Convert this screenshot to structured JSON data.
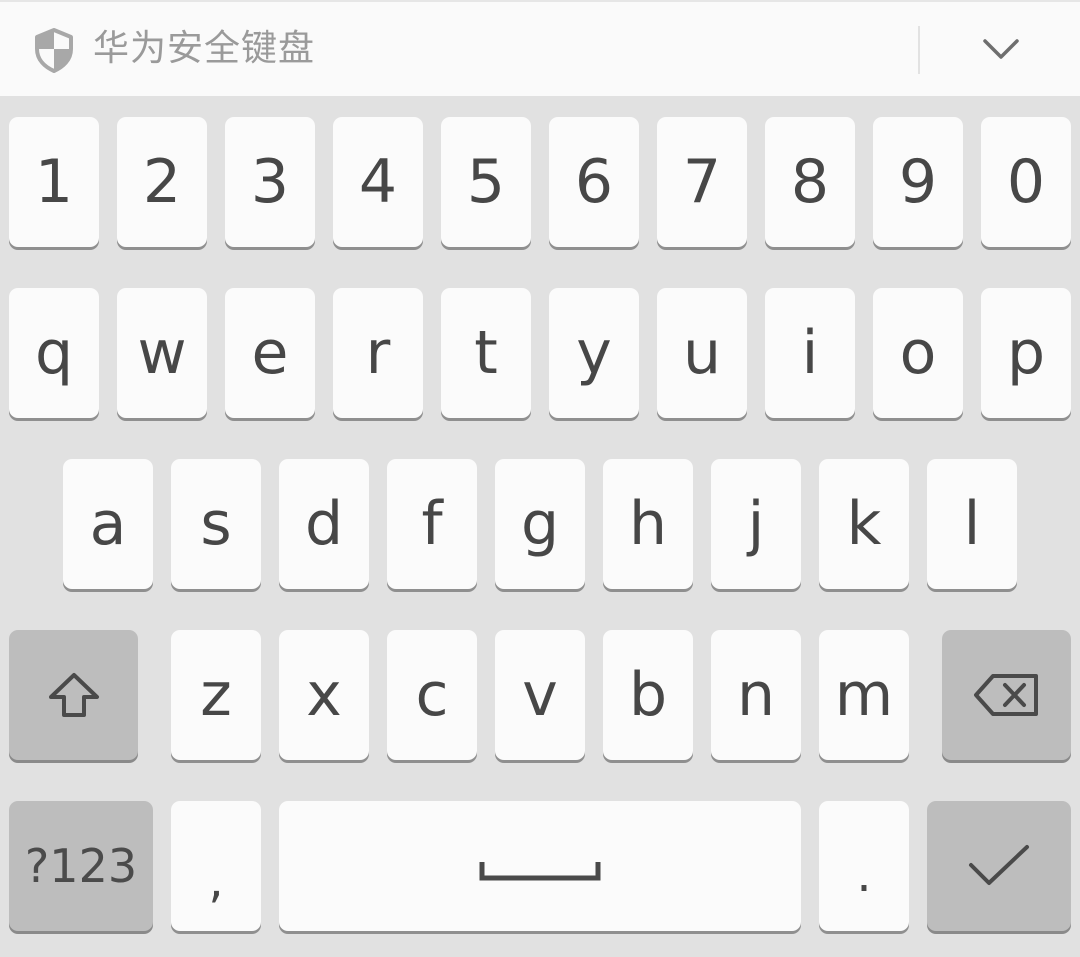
{
  "header": {
    "title": "华为安全键盘",
    "shield_icon": "shield-icon",
    "collapse_icon": "chevron-down-icon"
  },
  "keyboard": {
    "row_digits": [
      "1",
      "2",
      "3",
      "4",
      "5",
      "6",
      "7",
      "8",
      "9",
      "0"
    ],
    "row_top": [
      "q",
      "w",
      "e",
      "r",
      "t",
      "y",
      "u",
      "i",
      "o",
      "p"
    ],
    "row_home": [
      "a",
      "s",
      "d",
      "f",
      "g",
      "h",
      "j",
      "k",
      "l"
    ],
    "row_bottom": [
      "z",
      "x",
      "c",
      "v",
      "b",
      "n",
      "m"
    ],
    "shift_icon": "shift-arrow-icon",
    "backspace_icon": "backspace-icon",
    "symbols_label": "?123",
    "comma_label": ",",
    "period_label": ".",
    "space_icon": "space-bar-icon",
    "enter_icon": "checkmark-icon"
  },
  "colors": {
    "panel_background": "#e1e1e1",
    "key_background": "#fbfbfb",
    "function_key_background": "#bdbdbd",
    "key_text": "#474747",
    "header_text": "#9a9a9a"
  }
}
